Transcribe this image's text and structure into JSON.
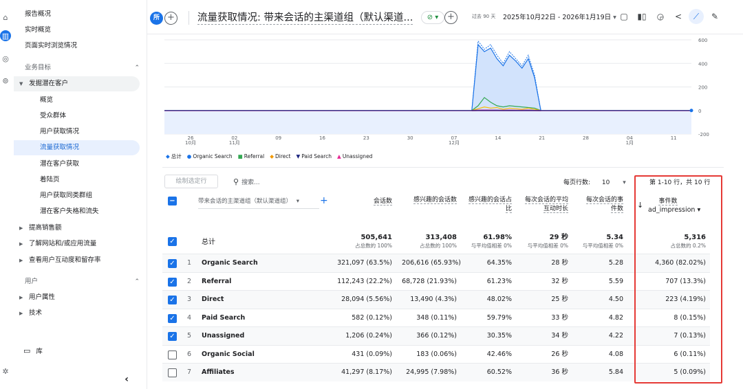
{
  "rail": {
    "icons": [
      "home-icon",
      "reports-icon",
      "explore-icon",
      "advertising-icon"
    ],
    "settings_icon": "settings-icon"
  },
  "nav": {
    "top_items": [
      "报告概况",
      "实时概览",
      "页面实时浏览情况"
    ],
    "section_label": "业务目标",
    "group_label": "发掘潜在客户",
    "group_items": [
      "概览",
      "受众群体",
      "用户获取情况",
      "流量获取情况",
      "潜在客户获取",
      "着陆页",
      "用户获取同类群组",
      "潜在客户失格和流失"
    ],
    "selected_item": "流量获取情况",
    "collapsed_groups": [
      "提高销售额",
      "了解网站和/或应用流量",
      "查看用户互动度和留存率"
    ],
    "user_section_label": "用户",
    "user_items": [
      "用户属性",
      "技术"
    ],
    "library_label": "库",
    "collapse_glyph": "‹"
  },
  "header": {
    "badge": "所",
    "title": "流量获取情况: 带来会话的主渠道组（默认渠道...",
    "status_glyph": "⊘ ▾",
    "date_range_prefix": "过去 90 天",
    "date_range": "2025年10月22日 - 2026年1月19日"
  },
  "toolbar": {
    "icons": [
      "report-icon",
      "compare-icon",
      "insights-icon",
      "share-icon",
      "trend-icon",
      "edit-icon"
    ]
  },
  "chart_data": {
    "type": "area",
    "x_ticks": [
      {
        "label": "26",
        "sub": "10月"
      },
      {
        "label": "02",
        "sub": "11月"
      },
      {
        "label": "09",
        "sub": ""
      },
      {
        "label": "16",
        "sub": ""
      },
      {
        "label": "23",
        "sub": ""
      },
      {
        "label": "30",
        "sub": ""
      },
      {
        "label": "07",
        "sub": "12月"
      },
      {
        "label": "14",
        "sub": ""
      },
      {
        "label": "21",
        "sub": ""
      },
      {
        "label": "28",
        "sub": ""
      },
      {
        "label": "04",
        "sub": "1月"
      },
      {
        "label": "11",
        "sub": ""
      },
      {
        "label": "18",
        "sub": ""
      }
    ],
    "y_ticks": [
      "600",
      "400",
      "200",
      "0",
      "-200"
    ],
    "ylim": [
      -200,
      600
    ],
    "series": [
      {
        "name": "总计",
        "color": "#1a73e8",
        "points": [
          [
            49,
            0
          ],
          [
            50,
            590
          ],
          [
            51,
            520
          ],
          [
            52,
            560
          ],
          [
            53,
            470
          ],
          [
            54,
            400
          ],
          [
            55,
            500
          ],
          [
            56,
            440
          ],
          [
            57,
            380
          ],
          [
            58,
            470
          ],
          [
            59,
            300
          ],
          [
            60,
            0
          ]
        ]
      },
      {
        "name": "Organic Search",
        "color": "#1a73e8",
        "points": [
          [
            49,
            0
          ],
          [
            50,
            560
          ],
          [
            51,
            500
          ],
          [
            52,
            530
          ],
          [
            53,
            440
          ],
          [
            54,
            380
          ],
          [
            55,
            470
          ],
          [
            56,
            420
          ],
          [
            57,
            360
          ],
          [
            58,
            440
          ],
          [
            59,
            280
          ],
          [
            60,
            0
          ]
        ]
      },
      {
        "name": "Referral",
        "color": "#34a853",
        "points": [
          [
            49,
            0
          ],
          [
            50,
            40
          ],
          [
            51,
            110
          ],
          [
            52,
            70
          ],
          [
            53,
            40
          ],
          [
            54,
            30
          ],
          [
            55,
            40
          ],
          [
            56,
            35
          ],
          [
            57,
            30
          ],
          [
            58,
            25
          ],
          [
            59,
            20
          ],
          [
            60,
            0
          ]
        ]
      },
      {
        "name": "Direct",
        "color": "#fbbc04",
        "points": [
          [
            49,
            0
          ],
          [
            50,
            15
          ],
          [
            51,
            30
          ],
          [
            52,
            20
          ],
          [
            53,
            25
          ],
          [
            54,
            10
          ],
          [
            55,
            20
          ],
          [
            56,
            15
          ],
          [
            57,
            10
          ],
          [
            58,
            20
          ],
          [
            59,
            10
          ],
          [
            60,
            0
          ]
        ]
      },
      {
        "name": "Paid Search",
        "color": "#1a237e",
        "points": [
          [
            49,
            0
          ],
          [
            50,
            2
          ],
          [
            51,
            3
          ],
          [
            52,
            2
          ],
          [
            53,
            2
          ],
          [
            54,
            1
          ],
          [
            55,
            2
          ],
          [
            56,
            1
          ],
          [
            57,
            1
          ],
          [
            58,
            2
          ],
          [
            59,
            1
          ],
          [
            60,
            0
          ]
        ]
      },
      {
        "name": "Unassigned",
        "color": "#e52592",
        "points": [
          [
            49,
            0
          ],
          [
            50,
            3
          ],
          [
            51,
            4
          ],
          [
            52,
            3
          ],
          [
            53,
            2
          ],
          [
            54,
            2
          ],
          [
            55,
            3
          ],
          [
            56,
            2
          ],
          [
            57,
            2
          ],
          [
            58,
            3
          ],
          [
            59,
            1
          ],
          [
            60,
            0
          ]
        ]
      }
    ],
    "legend": [
      {
        "name": "总计",
        "marker": "◆",
        "color": "#1a73e8"
      },
      {
        "name": "Organic Search",
        "marker": "●",
        "color": "#1a73e8"
      },
      {
        "name": "Referral",
        "marker": "■",
        "color": "#34a853"
      },
      {
        "name": "Direct",
        "marker": "◆",
        "color": "#f29900"
      },
      {
        "name": "Paid Search",
        "marker": "▼",
        "color": "#1a237e"
      },
      {
        "name": "Unassigned",
        "marker": "▲",
        "color": "#e52592"
      }
    ]
  },
  "filters": {
    "plot_rows_label": "绘制选定行",
    "search_placeholder": "搜索...",
    "rows_per_page_label": "每页行数:",
    "rows_per_page_value": "10",
    "pagination": "第 1-10 行，共 10 行"
  },
  "table": {
    "dimension_selector": "带来会话的主渠道组（默认渠道组）",
    "headers": [
      "会话数",
      "感兴趣的会话数",
      "感兴趣的会话占比",
      "每次会话的平均互动时长",
      "每次会话的事件数",
      "事件数",
      "ad_impression"
    ],
    "total": {
      "label": "总计",
      "values": [
        "505,641",
        "313,408",
        "61.98%",
        "29 秒",
        "5.34",
        "5,316"
      ],
      "subs": [
        "占总数的 100%",
        "占总数的 100%",
        "与平均值相差 0%",
        "与平均值相差 0%",
        "与平均值相差 0%",
        "占总数的 0.2%"
      ]
    },
    "rows": [
      {
        "idx": "1",
        "name": "Organic Search",
        "checked": true,
        "values": [
          "321,097 (63.5%)",
          "206,616 (65.93%)",
          "64.35%",
          "28 秒",
          "5.28",
          "4,360 (82.02%)"
        ]
      },
      {
        "idx": "2",
        "name": "Referral",
        "checked": true,
        "values": [
          "112,243 (22.2%)",
          "68,728 (21.93%)",
          "61.23%",
          "32 秒",
          "5.59",
          "707 (13.3%)"
        ]
      },
      {
        "idx": "3",
        "name": "Direct",
        "checked": true,
        "values": [
          "28,094 (5.56%)",
          "13,490 (4.3%)",
          "48.02%",
          "25 秒",
          "4.50",
          "223 (4.19%)"
        ]
      },
      {
        "idx": "4",
        "name": "Paid Search",
        "checked": true,
        "values": [
          "582 (0.12%)",
          "348 (0.11%)",
          "59.79%",
          "33 秒",
          "4.82",
          "8 (0.15%)"
        ]
      },
      {
        "idx": "5",
        "name": "Unassigned",
        "checked": true,
        "values": [
          "1,206 (0.24%)",
          "366 (0.12%)",
          "30.35%",
          "34 秒",
          "4.22",
          "7 (0.13%)"
        ]
      },
      {
        "idx": "6",
        "name": "Organic Social",
        "checked": false,
        "values": [
          "431 (0.09%)",
          "183 (0.06%)",
          "42.46%",
          "26 秒",
          "4.08",
          "6 (0.11%)"
        ]
      },
      {
        "idx": "7",
        "name": "Affiliates",
        "checked": false,
        "values": [
          "41,297 (8.17%)",
          "24,995 (7.98%)",
          "60.52%",
          "36 秒",
          "5.84",
          "5 (0.09%)"
        ]
      }
    ]
  },
  "annotation": {
    "highlight_color": "#e53935"
  }
}
